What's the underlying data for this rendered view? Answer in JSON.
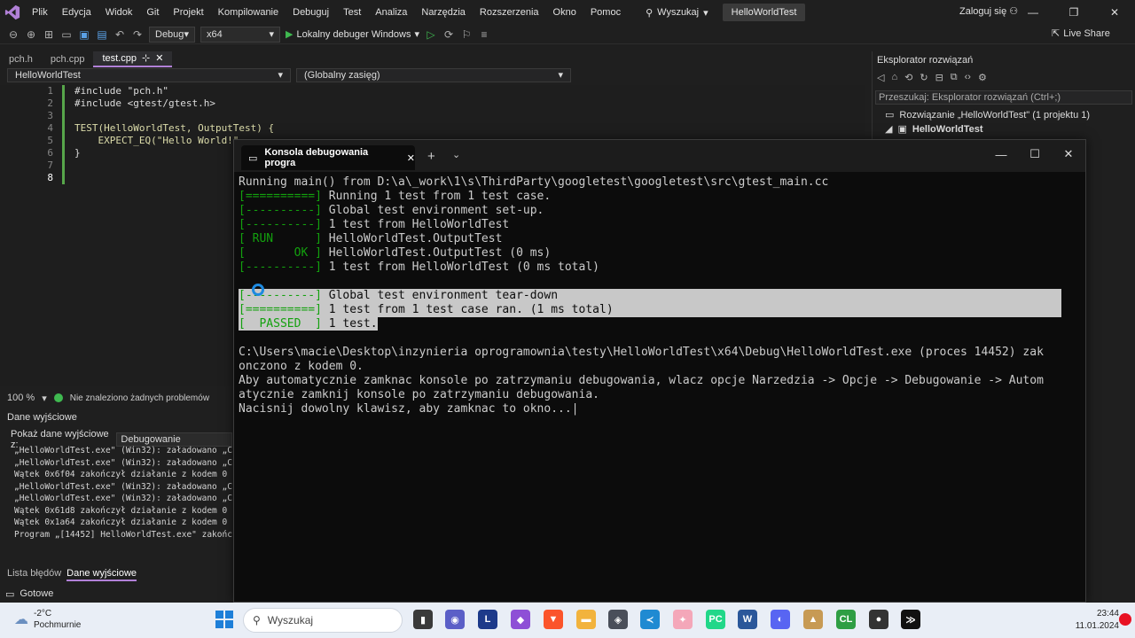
{
  "menubar": {
    "items": [
      "Plik",
      "Edycja",
      "Widok",
      "Git",
      "Projekt",
      "Kompilowanie",
      "Debuguj",
      "Test",
      "Analiza",
      "Narzędzia",
      "Rozszerzenia",
      "Okno",
      "Pomoc"
    ],
    "search_label": "Wyszukaj",
    "solution_title": "HelloWorldTest",
    "login": "Zaloguj się"
  },
  "toolbar": {
    "config": "Debug",
    "platform": "x64",
    "run_label": "Lokalny debuger Windows",
    "live_share": "Live Share"
  },
  "editor": {
    "tabs": [
      "pch.h",
      "pch.cpp",
      "test.cpp"
    ],
    "active_tab_pin": "⊹",
    "project_dropdown": "HelloWorldTest",
    "scope_dropdown": "(Globalny zasięg)",
    "line_numbers": [
      "1",
      "2",
      "3",
      "4",
      "5",
      "6",
      "7",
      "8"
    ],
    "lines": [
      "#include \"pch.h\"",
      "#include <gtest/gtest.h>",
      "",
      "TEST(HelloWorldTest, OutputTest) {",
      "    EXPECT_EQ(\"Hello World!\",",
      "}",
      "",
      ""
    ],
    "zoom": "100 %",
    "issues": "Nie znaleziono żadnych problemów"
  },
  "output": {
    "title": "Dane wyjściowe",
    "show_from_label": "Pokaż dane wyjściowe z:",
    "source": "Debugowanie",
    "lines": [
      "„HelloWorldTest.exe\" (Win32): załadowano „C:\\",
      "„HelloWorldTest.exe\" (Win32): załadowano „C:\\",
      "Wątek 0x6f04 zakończył działanie z kodem 0 (0",
      "„HelloWorldTest.exe\" (Win32): załadowano „C:\\",
      "„HelloWorldTest.exe\" (Win32): załadowano „C:\\",
      "Wątek 0x61d8 zakończył działanie z kodem 0 (0",
      "Wątek 0x1a64 zakończył działanie z kodem 0 (0",
      "Program „[14452] HelloWorldTest.exe\" zakończy"
    ],
    "bottom_tabs": [
      "Lista błędów",
      "Dane wyjściowe"
    ]
  },
  "statusbar": {
    "text": "Gotowe"
  },
  "solution_explorer": {
    "title": "Eksplorator rozwiązań",
    "search_placeholder": "Przeszukaj: Eksplorator rozwiązań (Ctrl+;)",
    "solution_item": "Rozwiązanie „HelloWorldTest\" (1 projektu 1)",
    "project_item": "HelloWorldTest"
  },
  "console": {
    "tab_title": "Konsola debugowania progra",
    "lines": [
      {
        "prefix": "",
        "text": "Running main() from D:\\a\\_work\\1\\s\\ThirdParty\\googletest\\googletest\\src\\gtest_main.cc",
        "hl": false
      },
      {
        "prefix": "[==========]",
        "text": " Running 1 test from 1 test case.",
        "hl": false
      },
      {
        "prefix": "[----------]",
        "text": " Global test environment set-up.",
        "hl": false
      },
      {
        "prefix": "[----------]",
        "text": " 1 test from HelloWorldTest",
        "hl": false
      },
      {
        "prefix": "[ RUN      ]",
        "text": " HelloWorldTest.OutputTest",
        "hl": false
      },
      {
        "prefix": "[       OK ]",
        "text": " HelloWorldTest.OutputTest (0 ms)",
        "hl": false
      },
      {
        "prefix": "[----------]",
        "text": " 1 test from HelloWorldTest (0 ms total)",
        "hl": false
      },
      {
        "prefix": "",
        "text": "",
        "hl": false
      },
      {
        "prefix": "[----------]",
        "text": " Global test environment tear-down",
        "hl": true
      },
      {
        "prefix": "[==========]",
        "text": " 1 test from 1 test case ran. (1 ms total)",
        "hl": true
      },
      {
        "prefix": "[  PASSED  ]",
        "text": " 1 test.",
        "hl": true
      },
      {
        "prefix": "",
        "text": "",
        "hl": false
      },
      {
        "prefix": "",
        "text": "C:\\Users\\macie\\Desktop\\inzynieria oprogramownia\\testy\\HelloWorldTest\\x64\\Debug\\HelloWorldTest.exe (proces 14452) zak",
        "hl": false
      },
      {
        "prefix": "",
        "text": "onczono z kodem 0.",
        "hl": false
      },
      {
        "prefix": "",
        "text": "Aby automatycznie zamknac konsole po zatrzymaniu debugowania, wlacz opcje Narzedzia -> Opcje -> Debugowanie -> Autom",
        "hl": false
      },
      {
        "prefix": "",
        "text": "atycznie zamknij konsole po zatrzymaniu debugowania.",
        "hl": false
      },
      {
        "prefix": "",
        "text": "Nacisnij dowolny klawisz, aby zamknac to okno...|",
        "hl": false
      }
    ]
  },
  "taskbar": {
    "temperature": "-2°C",
    "weather": "Pochmurnie",
    "search_label": "Wyszukaj",
    "time": "23:44",
    "date": "11.01.2024"
  },
  "colors": {
    "accent": "#b180d7",
    "console_green": "#13a10e",
    "highlight": "#c8c8c8"
  }
}
